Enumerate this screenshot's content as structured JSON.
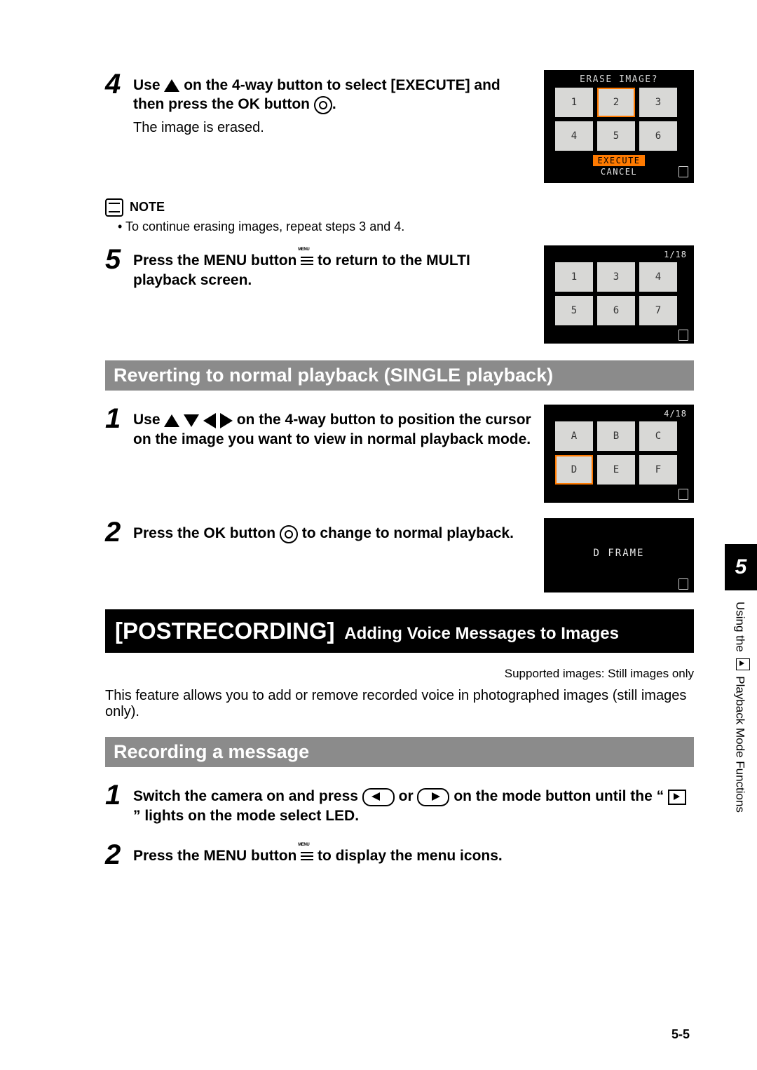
{
  "steps_a": {
    "four": {
      "num": "4",
      "bold_a": "Use ",
      "bold_b": " on the 4-way button to select [EXECUTE] and then press the OK button ",
      "bold_c": ".",
      "sub": "The image is erased."
    },
    "five": {
      "num": "5",
      "bold_a": "Press the MENU button ",
      "bold_b": " to return to the MULTI playback screen."
    }
  },
  "note": {
    "label": "NOTE",
    "bullet": "To continue erasing images, repeat steps 3 and 4."
  },
  "lcd_erase": {
    "title": "ERASE IMAGE?",
    "cells": [
      "1",
      "2",
      "3",
      "4",
      "5",
      "6"
    ],
    "selected_index": 1,
    "menu_sel": "EXECUTE",
    "menu_other": "CANCEL"
  },
  "lcd_multi1": {
    "counter": "1/18",
    "cells": [
      "1",
      "3",
      "4",
      "5",
      "6",
      "7"
    ]
  },
  "heading_single": "Reverting to normal playback (SINGLE playback)",
  "steps_b": {
    "one": {
      "num": "1",
      "bold_a": "Use ",
      "bold_b": " on the 4-way button to position the cursor on the image you want to view in normal playback mode."
    },
    "two": {
      "num": "2",
      "bold_a": "Press the OK button ",
      "bold_b": " to change to normal playback."
    }
  },
  "lcd_multi2": {
    "counter": "4/18",
    "cells": [
      "A",
      "B",
      "C",
      "D",
      "E",
      "F"
    ],
    "selected_index": 3
  },
  "lcd_frame": {
    "label": "D FRAME"
  },
  "heading_post": {
    "big": "[POSTRECORDING]",
    "rest": "Adding Voice Messages to Images"
  },
  "support": "Supported images: Still images only",
  "intro": "This feature allows you to add or remove recorded voice in photographed images (still images only).",
  "heading_record": "Recording a message",
  "steps_c": {
    "one": {
      "num": "1",
      "bold_a": "Switch the camera on and press ",
      "bold_b": " or ",
      "bold_c": " on the mode button until the “",
      "bold_d": "” lights on the mode select LED."
    },
    "two": {
      "num": "2",
      "bold_a": "Press the MENU button ",
      "bold_b": " to display the menu icons."
    }
  },
  "side": {
    "chapter": "5",
    "text_a": "Using the ",
    "text_b": " Playback Mode Functions"
  },
  "page_num": "5-5"
}
